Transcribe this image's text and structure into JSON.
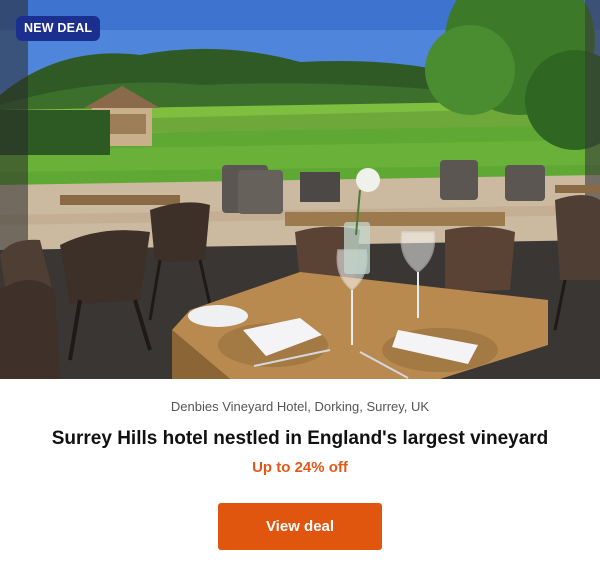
{
  "deal": {
    "badge": "NEW DEAL",
    "location": "Denbies Vineyard Hotel, Dorking, Surrey, UK",
    "title": "Surrey Hills hotel nestled in England's largest vineyard",
    "discount": "Up to 24% off",
    "cta_label": "View deal"
  },
  "colors": {
    "badge_bg": "#1b2f8f",
    "discount": "#e3581a",
    "cta_bg": "#e1560f"
  }
}
